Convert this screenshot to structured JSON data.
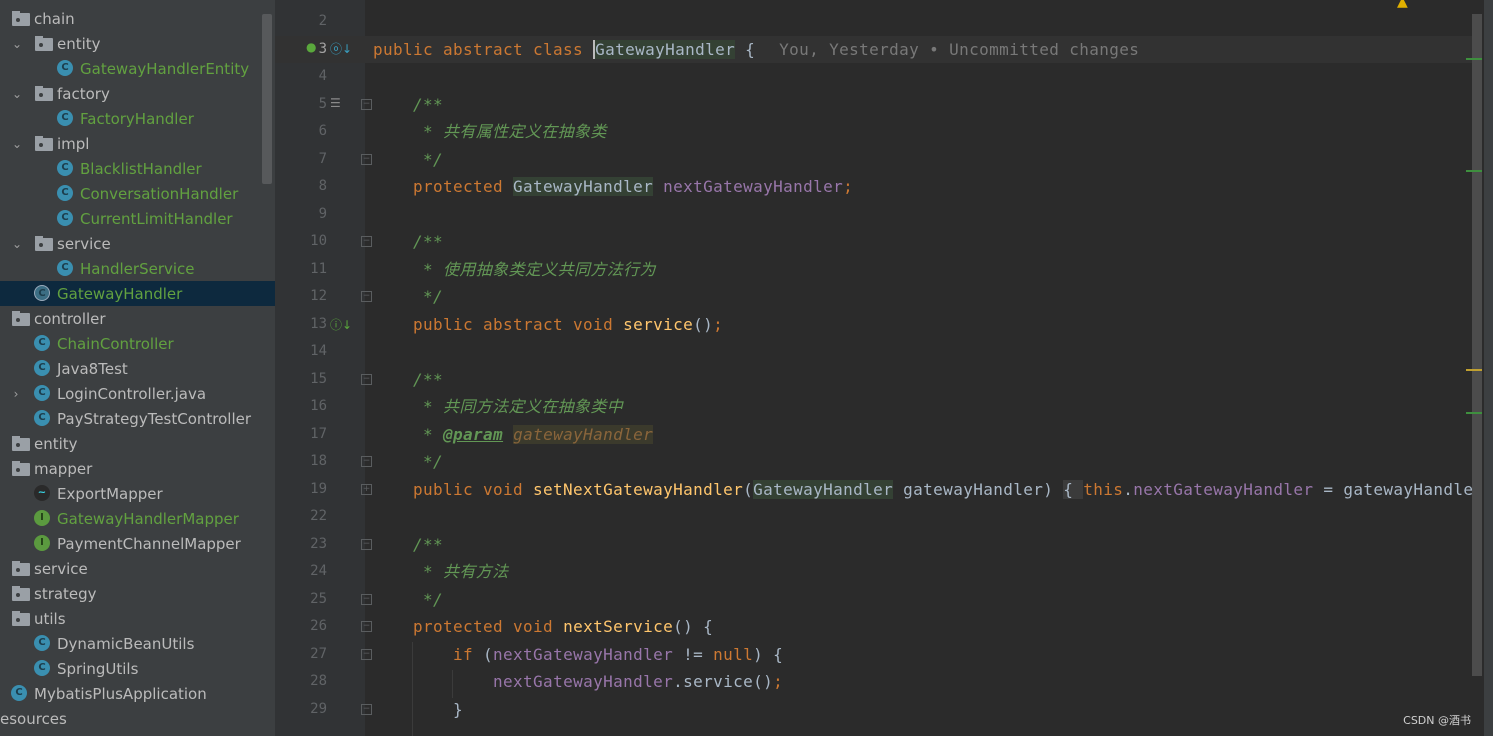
{
  "project_tree": {
    "items": [
      {
        "label": "chain",
        "type": "folder",
        "depth": 0,
        "expanded": null
      },
      {
        "label": "entity",
        "type": "folder",
        "depth": 1,
        "expanded": true
      },
      {
        "label": "GatewayHandlerEntity",
        "type": "class",
        "depth": 2,
        "color": "green"
      },
      {
        "label": "factory",
        "type": "folder",
        "depth": 1,
        "expanded": true
      },
      {
        "label": "FactoryHandler",
        "type": "class",
        "depth": 2,
        "color": "green"
      },
      {
        "label": "impl",
        "type": "folder",
        "depth": 1,
        "expanded": true
      },
      {
        "label": "BlacklistHandler",
        "type": "class",
        "depth": 2,
        "color": "green"
      },
      {
        "label": "ConversationHandler",
        "type": "class",
        "depth": 2,
        "color": "green"
      },
      {
        "label": "CurrentLimitHandler",
        "type": "class",
        "depth": 2,
        "color": "green"
      },
      {
        "label": "service",
        "type": "folder",
        "depth": 1,
        "expanded": true
      },
      {
        "label": "HandlerService",
        "type": "class",
        "depth": 2,
        "color": "green"
      },
      {
        "label": "GatewayHandler",
        "type": "abstract-class",
        "depth": 1,
        "color": "green",
        "selected": true
      },
      {
        "label": "controller",
        "type": "folder",
        "depth": 0
      },
      {
        "label": "ChainController",
        "type": "class",
        "depth": 1,
        "color": "green"
      },
      {
        "label": "Java8Test",
        "type": "runnable-class",
        "depth": 1
      },
      {
        "label": "LoginController.java",
        "type": "class",
        "depth": 1,
        "expanded": false
      },
      {
        "label": "PayStrategyTestController",
        "type": "class",
        "depth": 1
      },
      {
        "label": "entity",
        "type": "folder",
        "depth": 0
      },
      {
        "label": "mapper",
        "type": "folder",
        "depth": 0
      },
      {
        "label": "ExportMapper",
        "type": "mybatis",
        "depth": 1
      },
      {
        "label": "GatewayHandlerMapper",
        "type": "interface",
        "depth": 1,
        "color": "green"
      },
      {
        "label": "PaymentChannelMapper",
        "type": "interface",
        "depth": 1
      },
      {
        "label": "service",
        "type": "folder",
        "depth": 0
      },
      {
        "label": "strategy",
        "type": "folder",
        "depth": 0
      },
      {
        "label": "utils",
        "type": "folder",
        "depth": 0
      },
      {
        "label": "DynamicBeanUtils",
        "type": "class",
        "depth": 1
      },
      {
        "label": "SpringUtils",
        "type": "class",
        "depth": 1
      },
      {
        "label": "MybatisPlusApplication",
        "type": "spring-app",
        "depth": 0
      },
      {
        "label": "esources",
        "type": "text",
        "depth": -1
      }
    ]
  },
  "editor": {
    "current_line": 3,
    "lines": [
      {
        "n": "2",
        "tokens": []
      },
      {
        "n": "3",
        "tokens": [
          [
            "public abstract class ",
            "keyword"
          ],
          [
            "GatewayHandler",
            "ref-caret"
          ],
          [
            " {",
            "plain"
          ],
          [
            "You, Yesterday • Uncommitted changes",
            "hint"
          ]
        ]
      },
      {
        "n": "4",
        "tokens": []
      },
      {
        "n": "5",
        "tokens": [
          [
            "    /**",
            "comment"
          ]
        ]
      },
      {
        "n": "6",
        "tokens": [
          [
            "     * 共有属性定义在抽象类",
            "comment"
          ]
        ]
      },
      {
        "n": "7",
        "tokens": [
          [
            "     */",
            "comment"
          ]
        ]
      },
      {
        "n": "8",
        "tokens": [
          [
            "    protected ",
            "keyword"
          ],
          [
            "GatewayHandler",
            "ref"
          ],
          [
            " ",
            "plain"
          ],
          [
            "nextGatewayHandler",
            "field"
          ],
          [
            ";",
            "keyword"
          ]
        ]
      },
      {
        "n": "9",
        "tokens": []
      },
      {
        "n": "10",
        "tokens": [
          [
            "    /**",
            "comment"
          ]
        ]
      },
      {
        "n": "11",
        "tokens": [
          [
            "     * 使用抽象类定义共同方法行为",
            "comment"
          ]
        ]
      },
      {
        "n": "12",
        "tokens": [
          [
            "     */",
            "comment"
          ]
        ]
      },
      {
        "n": "13",
        "tokens": [
          [
            "    public abstract void ",
            "keyword"
          ],
          [
            "service",
            "method"
          ],
          [
            "()",
            "plain"
          ],
          [
            ";",
            "keyword"
          ]
        ]
      },
      {
        "n": "14",
        "tokens": []
      },
      {
        "n": "15",
        "tokens": [
          [
            "    /**",
            "comment"
          ]
        ]
      },
      {
        "n": "16",
        "tokens": [
          [
            "     * 共同方法定义在抽象类中",
            "comment"
          ]
        ]
      },
      {
        "n": "17",
        "tokens": [
          [
            "     * ",
            "comment"
          ],
          [
            "@param",
            "doctag"
          ],
          [
            " ",
            "comment"
          ],
          [
            "gatewayHandler",
            "param"
          ]
        ]
      },
      {
        "n": "18",
        "tokens": [
          [
            "     */",
            "comment"
          ]
        ]
      },
      {
        "n": "19",
        "tokens": [
          [
            "    public void ",
            "keyword"
          ],
          [
            "setNextGatewayHandler",
            "method"
          ],
          [
            "(",
            "plain"
          ],
          [
            "GatewayHandler",
            "ref"
          ],
          [
            " gatewayHandler) ",
            "plain"
          ],
          [
            "{ ",
            "brace"
          ],
          [
            "this",
            "keyword"
          ],
          [
            ".",
            "plain"
          ],
          [
            "nextGatewayHandler",
            "field"
          ],
          [
            " = gatewayHandler",
            "plain"
          ]
        ]
      },
      {
        "n": "22",
        "tokens": []
      },
      {
        "n": "23",
        "tokens": [
          [
            "    /**",
            "comment"
          ]
        ]
      },
      {
        "n": "24",
        "tokens": [
          [
            "     * 共有方法",
            "comment"
          ]
        ]
      },
      {
        "n": "25",
        "tokens": [
          [
            "     */",
            "comment"
          ]
        ]
      },
      {
        "n": "26",
        "tokens": [
          [
            "    protected void ",
            "keyword"
          ],
          [
            "nextService",
            "method"
          ],
          [
            "() {",
            "plain"
          ]
        ]
      },
      {
        "n": "27",
        "tokens": [
          [
            "        if ",
            "keyword"
          ],
          [
            "(",
            "plain"
          ],
          [
            "nextGatewayHandler",
            "field"
          ],
          [
            " != ",
            "plain"
          ],
          [
            "null",
            "keyword"
          ],
          [
            ") {",
            "plain"
          ]
        ]
      },
      {
        "n": "28",
        "tokens": [
          [
            "            ",
            "plain"
          ],
          [
            "nextGatewayHandler",
            "field"
          ],
          [
            ".service()",
            "plain"
          ],
          [
            ";",
            "keyword"
          ]
        ]
      },
      {
        "n": "29",
        "tokens": [
          [
            "        }",
            "plain"
          ]
        ]
      }
    ]
  },
  "colors": {
    "keyword": "#cc7832",
    "comment": "#629755",
    "method": "#ffc66d",
    "field": "#9876aa",
    "text": "#a9b7c6",
    "tree_green": "#62a140"
  },
  "watermark": "CSDN @酒书"
}
